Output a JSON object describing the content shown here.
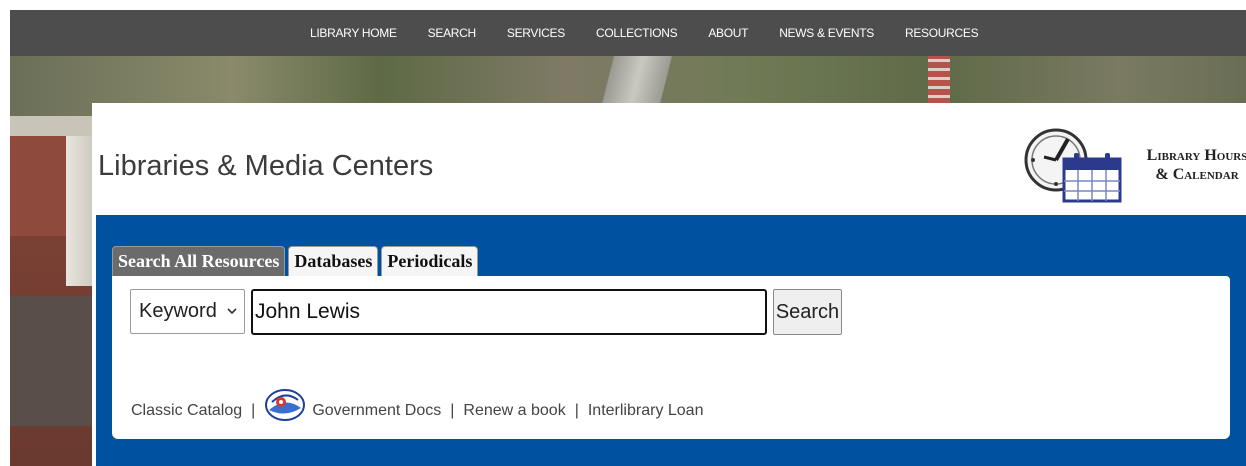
{
  "topnav": {
    "items": [
      "LIBRARY HOME",
      "SEARCH",
      "SERVICES",
      "COLLECTIONS",
      "ABOUT",
      "NEWS & EVENTS",
      "RESOURCES"
    ]
  },
  "site": {
    "title": "Libraries & Media Centers",
    "hours_line1": "Library Hours",
    "hours_line2": "& Calendar"
  },
  "search": {
    "tabs": [
      {
        "label": "Search All Resources",
        "active": true
      },
      {
        "label": "Databases",
        "active": false
      },
      {
        "label": "Periodicals",
        "active": false
      }
    ],
    "field_type": "Keyword",
    "query": "John Lewis",
    "button_label": "Search"
  },
  "links": {
    "classic_catalog": "Classic Catalog",
    "government_docs": "Government Docs",
    "renew": "Renew a book",
    "ill": "Interlibrary Loan",
    "separator": "|"
  },
  "colors": {
    "nav_bg": "#4d4d4d",
    "search_region": "#0051a0",
    "active_tab": "#6b6b6b"
  },
  "icons": [
    "clock-icon",
    "calendar-icon",
    "chevron-down-icon",
    "government-docs-seal-icon"
  ]
}
